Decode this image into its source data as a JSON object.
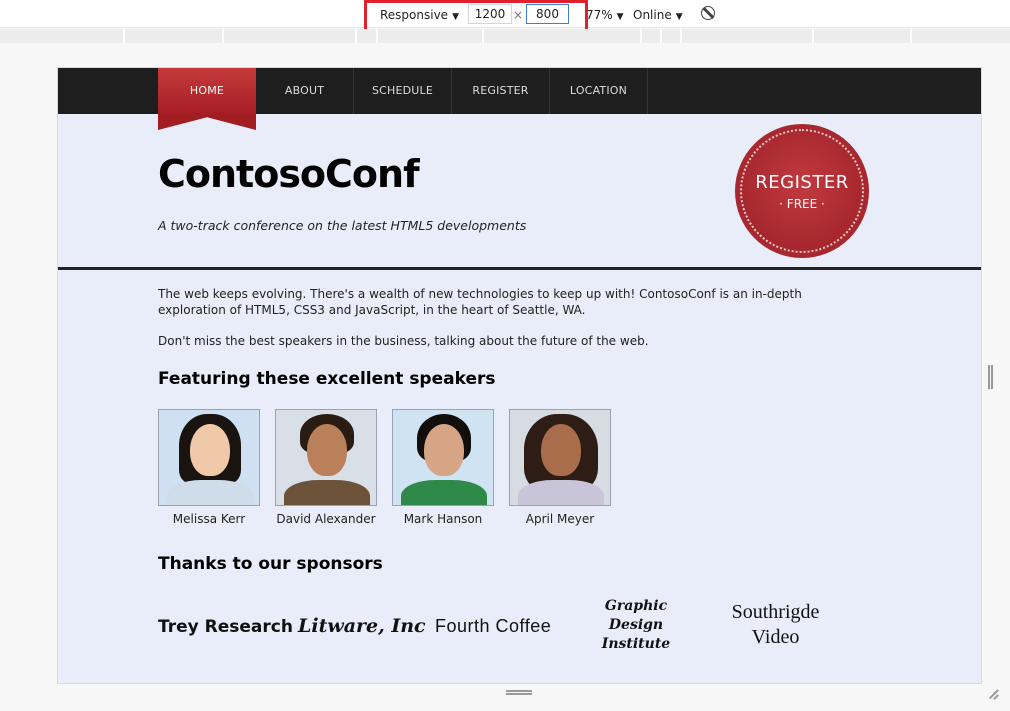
{
  "devtools": {
    "device": "Responsive",
    "width": "1200",
    "separator": "×",
    "height": "800",
    "zoom": "77%",
    "network": "Online",
    "rotate_icon": "rotate-icon"
  },
  "site": {
    "nav": [
      "HOME",
      "ABOUT",
      "SCHEDULE",
      "REGISTER",
      "LOCATION"
    ],
    "title": "ContosoConf",
    "tagline": "A two-track conference on the latest HTML5 developments",
    "badge": {
      "line1": "REGISTER",
      "line2": "· FREE ·"
    },
    "intro1": "The web keeps evolving. There's a wealth of new technologies to keep up with! ContosoConf is an in-depth exploration of HTML5, CSS3 and JavaScript, in the heart of Seattle, WA.",
    "intro2": "Don't miss the best speakers in the business, talking about the future of the web.",
    "speakers_heading": "Featuring these excellent speakers",
    "speakers": [
      "Melissa Kerr",
      "David Alexander",
      "Mark Hanson",
      "April Meyer"
    ],
    "sponsors_heading": "Thanks to our sponsors",
    "sponsors": [
      "Trey Research",
      "Litware, Inc",
      "Fourth Coffee",
      "Graphic Design Institute",
      "Southrigde Video"
    ]
  },
  "colors": {
    "accent_red": "#a82830",
    "nav_bg": "#1e1e1e",
    "page_bg": "#e9ecf9",
    "highlight": "#e0202a"
  }
}
